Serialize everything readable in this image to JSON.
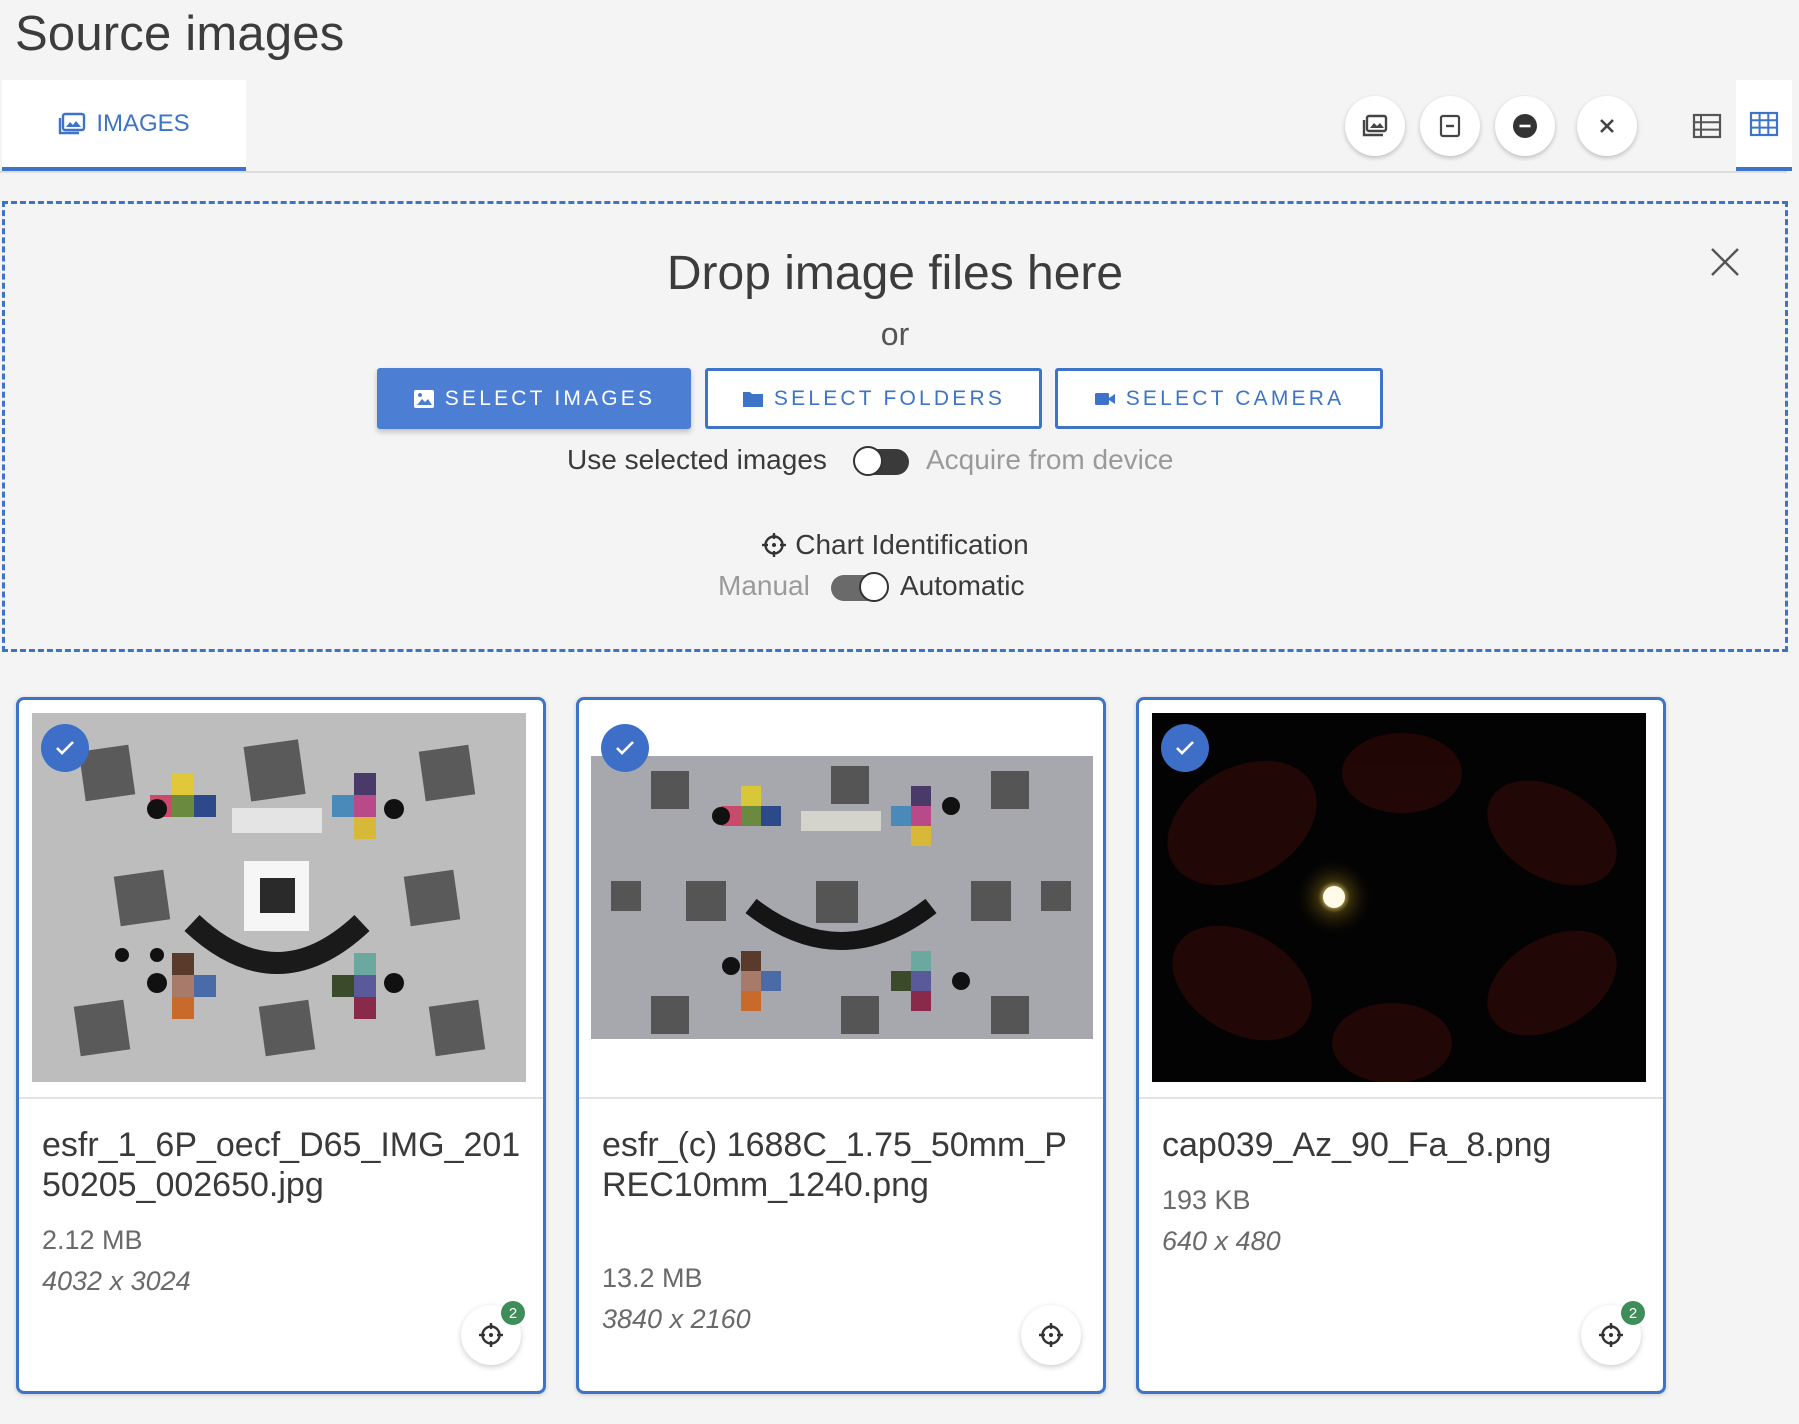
{
  "page": {
    "title": "Source images"
  },
  "tabs": [
    {
      "label": "IMAGES",
      "icon": "images-icon",
      "active": true
    }
  ],
  "toolbar": {
    "buttons": [
      {
        "icon": "image-library-icon"
      },
      {
        "icon": "square-minus-icon"
      },
      {
        "icon": "circle-minus-icon"
      },
      {
        "icon": "close-icon"
      }
    ],
    "views": [
      {
        "icon": "list-view-icon",
        "active": false
      },
      {
        "icon": "grid-view-icon",
        "active": true
      }
    ]
  },
  "dropzone": {
    "title": "Drop image files here",
    "or": "or",
    "select_images": "SELECT IMAGES",
    "select_folders": "SELECT FOLDERS",
    "select_camera": "SELECT CAMERA",
    "source_toggle": {
      "left": "Use selected images",
      "right": "Acquire from device",
      "value": "left"
    },
    "chart_identification": {
      "title": "Chart Identification",
      "left": "Manual",
      "right": "Automatic",
      "value": "right"
    }
  },
  "images": [
    {
      "name": "esfr_1_6P_oecf_D65_IMG_20150205_002650.jpg",
      "size": "2.12 MB",
      "dims": "4032 x 3024",
      "selected": true,
      "badge": "2"
    },
    {
      "name": "esfr_(c) 1688C_1.75_50mm_PREC10mm_1240.png",
      "size": "13.2 MB",
      "dims": "3840 x 2160",
      "selected": true,
      "badge": ""
    },
    {
      "name": "cap039_Az_90_Fa_8.png",
      "size": "193 KB",
      "dims": "640 x 480",
      "selected": true,
      "badge": "2"
    }
  ],
  "colors": {
    "accent": "#3d74c8",
    "badge": "#3f8e5a",
    "check": "#3d6fc9"
  }
}
